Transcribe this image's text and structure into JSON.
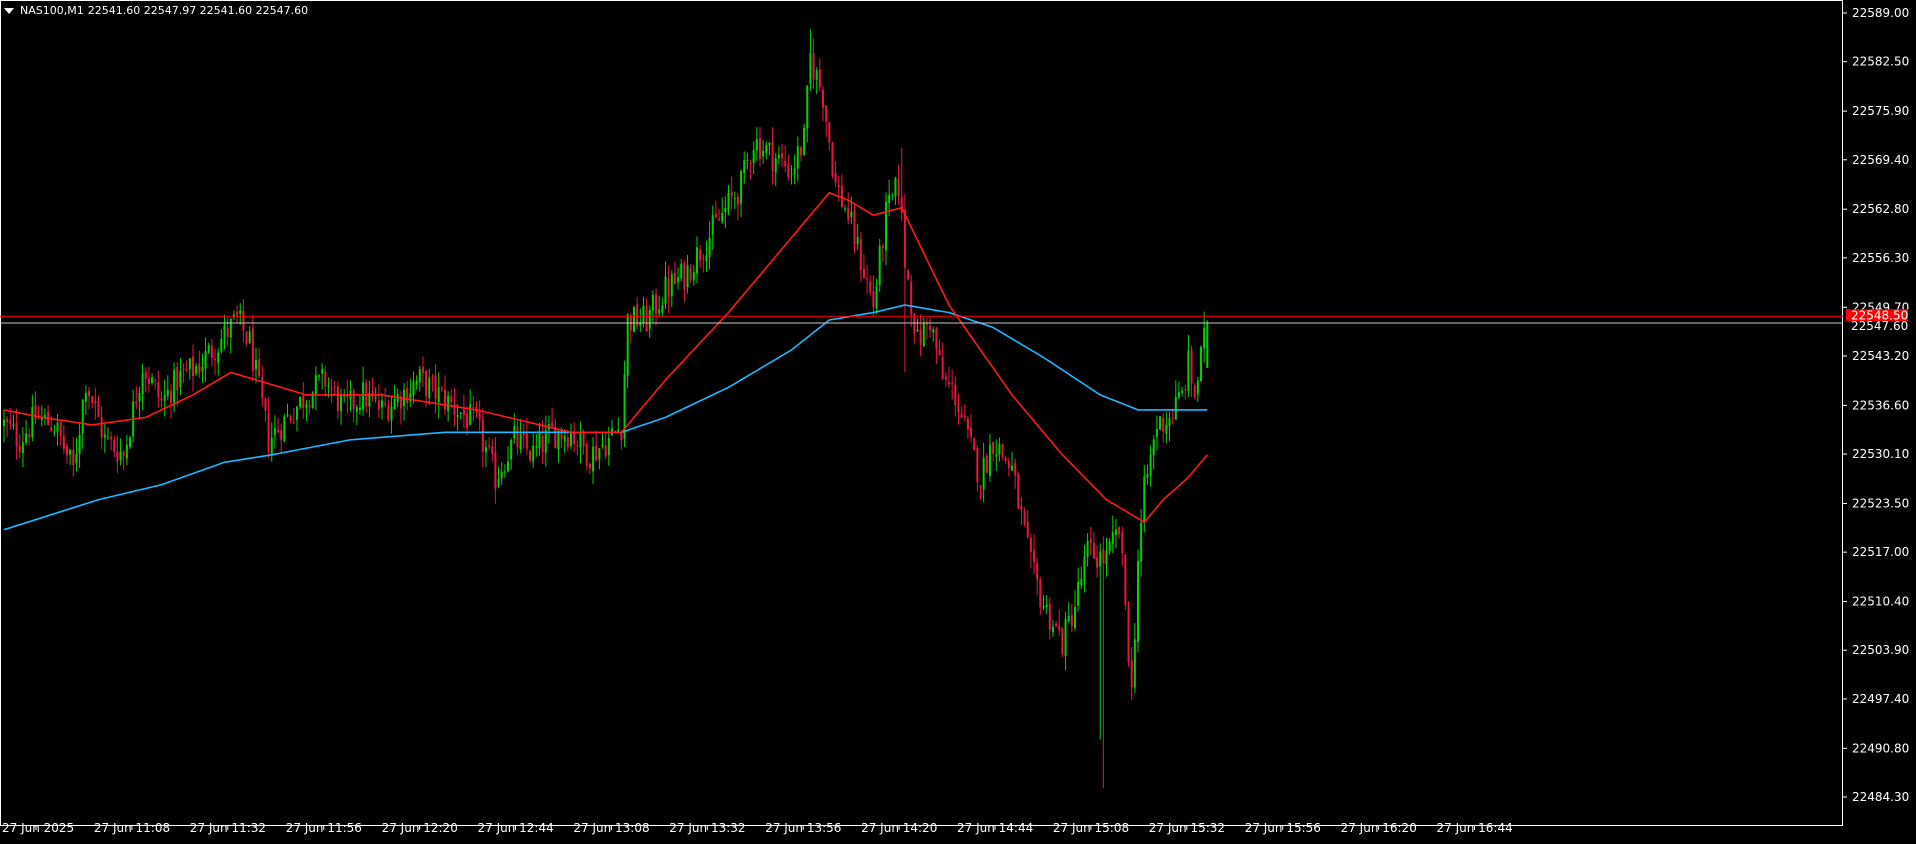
{
  "header": {
    "symbol": "NAS100,M1",
    "ohlc": "22541.60 22547.97 22541.60 22547.60"
  },
  "colors": {
    "background": "#000000",
    "bull_candle": "#00d300",
    "bear_candle": "#e8163c",
    "ma_fast": "#ff1a1a",
    "ma_slow": "#19b8ff",
    "axis": "#ffffff",
    "price_line": "#ff0000",
    "bid_label_bg": "#ff0000"
  },
  "chart_data": {
    "type": "candlestick",
    "symbol": "NAS100",
    "timeframe": "M1",
    "y_ticks": [
      "22589.00",
      "22582.50",
      "22575.90",
      "22569.40",
      "22562.80",
      "22556.30",
      "22549.70",
      "22543.20",
      "22536.60",
      "22530.10",
      "22523.50",
      "22517.00",
      "22510.40",
      "22503.90",
      "22497.40",
      "22490.80",
      "22484.30"
    ],
    "x_ticks": [
      "27 Jun 2025",
      "27 Jun 11:08",
      "27 Jun 11:32",
      "27 Jun 11:56",
      "27 Jun 12:20",
      "27 Jun 12:44",
      "27 Jun 13:08",
      "27 Jun 13:32",
      "27 Jun 13:56",
      "27 Jun 14:20",
      "27 Jun 14:44",
      "27 Jun 15:08",
      "27 Jun 15:32",
      "27 Jun 15:56",
      "27 Jun 16:20",
      "27 Jun 16:44"
    ],
    "ylim": [
      22482.7,
      22590.6
    ],
    "current_price": 22547.6,
    "price_labels": [
      "22548.50",
      "22547.60"
    ],
    "price_levels": [
      22548.5,
      22547.6
    ],
    "close_path": [
      [
        0,
        22534
      ],
      [
        5,
        22532
      ],
      [
        10,
        22535
      ],
      [
        16,
        22534
      ],
      [
        22,
        22528
      ],
      [
        26,
        22540
      ],
      [
        32,
        22532
      ],
      [
        38,
        22530
      ],
      [
        44,
        22542
      ],
      [
        50,
        22537
      ],
      [
        55,
        22540
      ],
      [
        62,
        22542
      ],
      [
        68,
        22545
      ],
      [
        74,
        22548
      ],
      [
        78,
        22545
      ],
      [
        84,
        22532
      ],
      [
        90,
        22535
      ],
      [
        96,
        22538
      ],
      [
        102,
        22540
      ],
      [
        108,
        22536
      ],
      [
        114,
        22538
      ],
      [
        120,
        22536
      ],
      [
        126,
        22538
      ],
      [
        132,
        22540
      ],
      [
        138,
        22538
      ],
      [
        144,
        22536
      ],
      [
        150,
        22534
      ],
      [
        156,
        22527
      ],
      [
        162,
        22532
      ],
      [
        168,
        22530
      ],
      [
        174,
        22533
      ],
      [
        180,
        22533
      ],
      [
        186,
        22530
      ],
      [
        192,
        22532
      ],
      [
        196,
        22534
      ],
      [
        198,
        22548
      ],
      [
        204,
        22548
      ],
      [
        210,
        22552
      ],
      [
        216,
        22554
      ],
      [
        222,
        22558
      ],
      [
        228,
        22562
      ],
      [
        234,
        22566
      ],
      [
        238,
        22572
      ],
      [
        244,
        22570
      ],
      [
        250,
        22568
      ],
      [
        254,
        22572
      ],
      [
        256,
        22583
      ],
      [
        260,
        22578
      ],
      [
        264,
        22566
      ],
      [
        268,
        22562
      ],
      [
        272,
        22556
      ],
      [
        276,
        22550
      ],
      [
        280,
        22562
      ],
      [
        284,
        22566
      ],
      [
        286,
        22556
      ],
      [
        290,
        22545
      ],
      [
        294,
        22548
      ],
      [
        298,
        22540
      ],
      [
        302,
        22538
      ],
      [
        306,
        22532
      ],
      [
        310,
        22527
      ],
      [
        314,
        22532
      ],
      [
        320,
        22528
      ],
      [
        326,
        22515
      ],
      [
        330,
        22510
      ],
      [
        336,
        22505
      ],
      [
        340,
        22510
      ],
      [
        344,
        22517
      ],
      [
        350,
        22516
      ],
      [
        354,
        22520
      ],
      [
        356,
        22510
      ],
      [
        358,
        22498
      ],
      [
        360,
        22516
      ],
      [
        362,
        22525
      ],
      [
        366,
        22534
      ],
      [
        370,
        22535
      ],
      [
        374,
        22538
      ],
      [
        376,
        22542
      ],
      [
        378,
        22538
      ],
      [
        382,
        22547.6
      ]
    ],
    "ma_fast": [
      [
        0,
        22536
      ],
      [
        12,
        22535
      ],
      [
        28,
        22534
      ],
      [
        45,
        22535
      ],
      [
        60,
        22538
      ],
      [
        72,
        22541
      ],
      [
        80,
        22540
      ],
      [
        96,
        22538
      ],
      [
        120,
        22538
      ],
      [
        150,
        22536
      ],
      [
        180,
        22533
      ],
      [
        196,
        22533
      ],
      [
        210,
        22540
      ],
      [
        230,
        22549
      ],
      [
        250,
        22559
      ],
      [
        262,
        22565
      ],
      [
        268,
        22564
      ],
      [
        276,
        22562
      ],
      [
        285,
        22563
      ],
      [
        300,
        22550
      ],
      [
        320,
        22538
      ],
      [
        336,
        22530
      ],
      [
        350,
        22524
      ],
      [
        358,
        22522
      ],
      [
        362,
        22521
      ],
      [
        368,
        22524
      ],
      [
        376,
        22527
      ],
      [
        382,
        22530
      ]
    ],
    "ma_slow": [
      [
        0,
        22520
      ],
      [
        15,
        22522
      ],
      [
        30,
        22524
      ],
      [
        50,
        22526
      ],
      [
        70,
        22529
      ],
      [
        85,
        22530
      ],
      [
        110,
        22532
      ],
      [
        140,
        22533
      ],
      [
        170,
        22533
      ],
      [
        196,
        22533
      ],
      [
        210,
        22535
      ],
      [
        230,
        22539
      ],
      [
        250,
        22544
      ],
      [
        262,
        22548
      ],
      [
        276,
        22549
      ],
      [
        286,
        22550
      ],
      [
        300,
        22549
      ],
      [
        314,
        22547
      ],
      [
        330,
        22543
      ],
      [
        348,
        22538
      ],
      [
        360,
        22536
      ],
      [
        370,
        22536
      ],
      [
        382,
        22536
      ]
    ]
  }
}
